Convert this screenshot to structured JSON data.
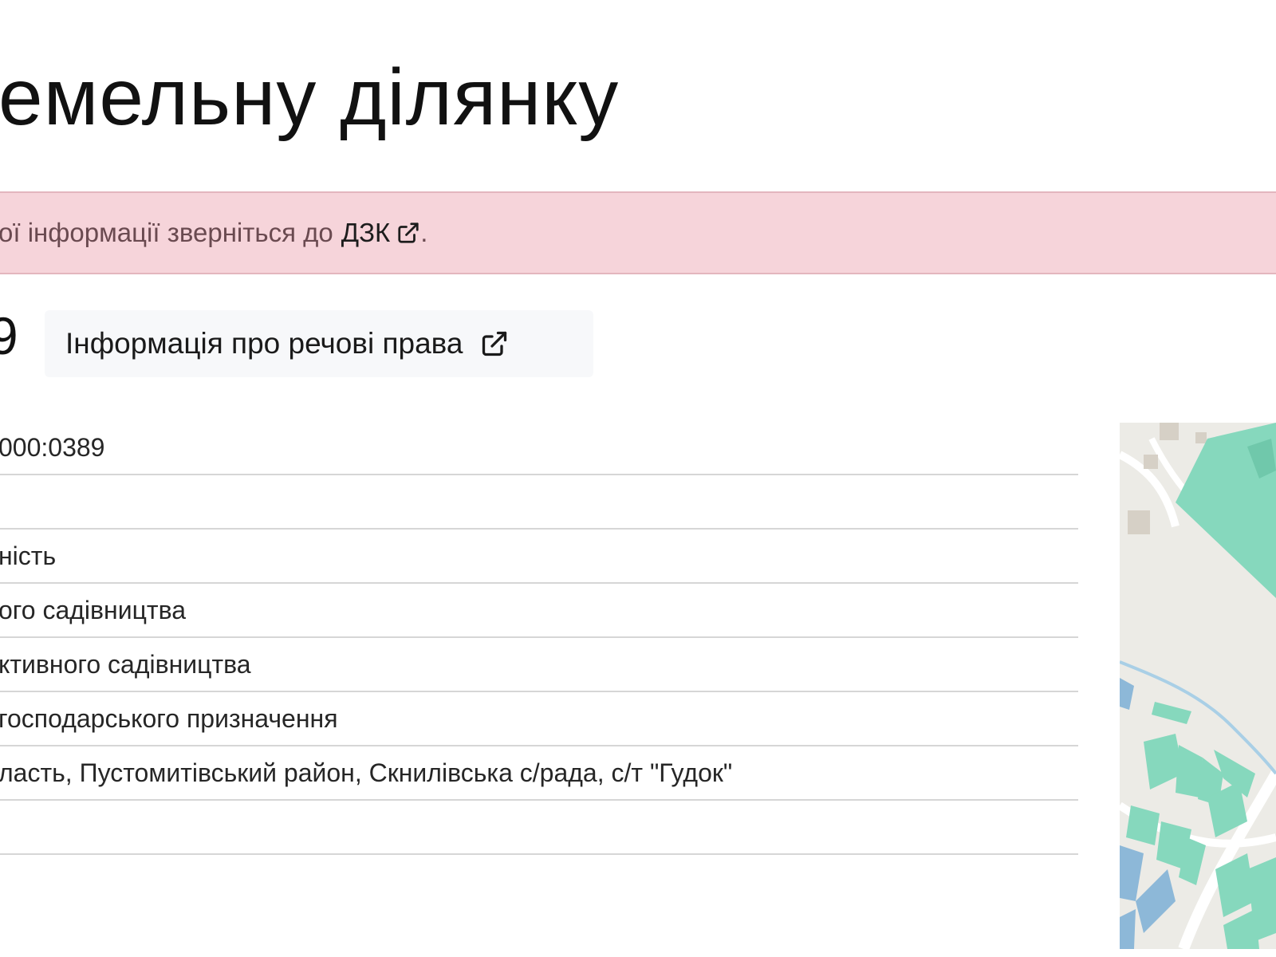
{
  "page": {
    "title": "емельну ділянку"
  },
  "alert": {
    "text": "ої інформації зверніться до",
    "link_label": "ДЗК",
    "trailing": "."
  },
  "parcel": {
    "number_fragment": "9",
    "rights_button_label": "Інформація про речові права"
  },
  "details": {
    "rows": [
      "000:0389",
      "",
      "ність",
      "ого садівництва",
      "ктивного садівництва",
      "господарського призначення",
      "ласть, Пустомитівський район, Скнилівська с/рада, с/т \"Гудок\"",
      ""
    ]
  },
  "colors": {
    "alert_bg": "#f6d4da",
    "map_parcel_green": "#86d8bd",
    "map_parcel_blue": "#8db8d8",
    "map_ground": "#ecebe6"
  }
}
